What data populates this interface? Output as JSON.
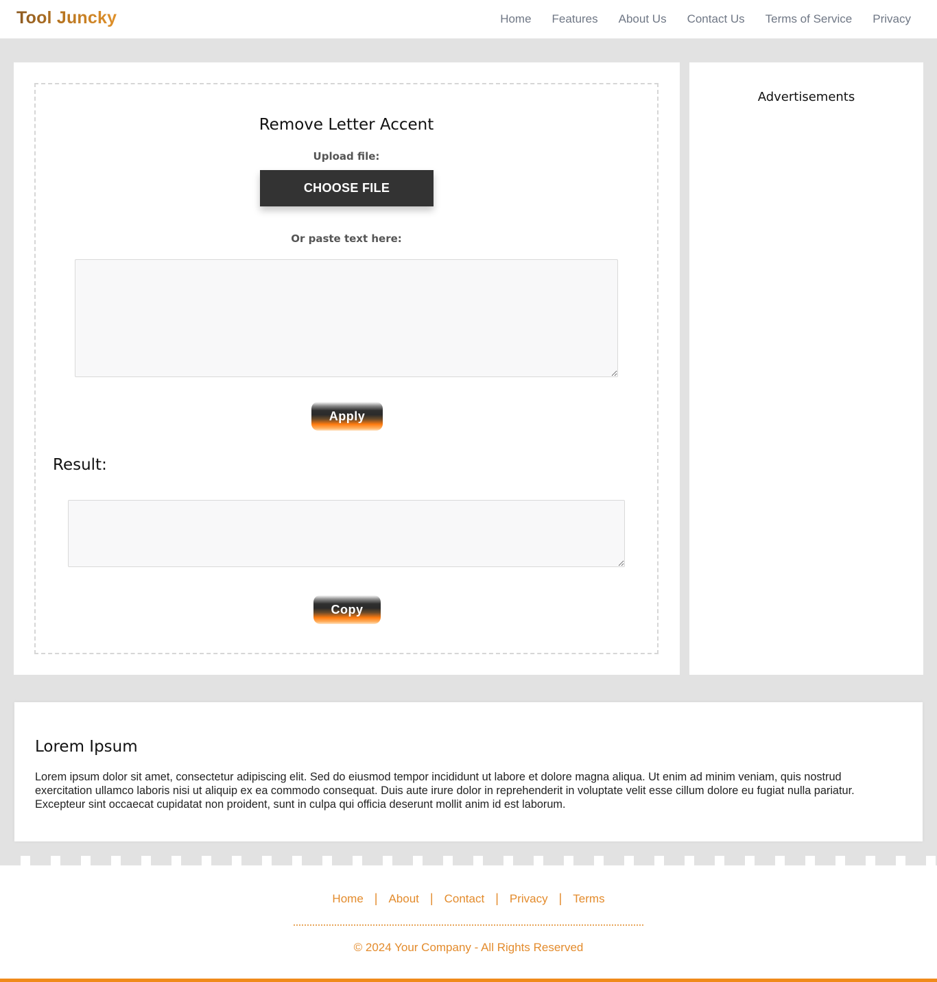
{
  "header": {
    "brand": "Tool Juncky",
    "nav": [
      "Home",
      "Features",
      "About Us",
      "Contact Us",
      "Terms of Service",
      "Privacy"
    ]
  },
  "tool": {
    "title": "Remove Letter Accent",
    "upload_label": "Upload file:",
    "choose_file_label": "CHOOSE FILE",
    "paste_label": "Or paste text here:",
    "input_value": "",
    "apply_label": "Apply",
    "result_title": "Result:",
    "output_value": "",
    "copy_label": "Copy"
  },
  "ads": {
    "title": "Advertisements"
  },
  "lorem": {
    "title": "Lorem Ipsum",
    "text": "Lorem ipsum dolor sit amet, consectetur adipiscing elit. Sed do eiusmod tempor incididunt ut labore et dolore magna aliqua. Ut enim ad minim veniam, quis nostrud exercitation ullamco laboris nisi ut aliquip ex ea commodo consequat. Duis aute irure dolor in reprehenderit in voluptate velit esse cillum dolore eu fugiat nulla pariatur. Excepteur sint occaecat cupidatat non proident, sunt in culpa qui officia deserunt mollit anim id est laborum."
  },
  "footer": {
    "links": [
      "Home",
      "About",
      "Contact",
      "Privacy",
      "Terms"
    ],
    "separator": "|",
    "copyright": "© 2024 Your Company - All Rights Reserved"
  },
  "colors": {
    "accent": "#f08a1a",
    "footer_text": "#e38b2c",
    "button_dark": "#333333",
    "page_bg": "#e2e2e2"
  }
}
